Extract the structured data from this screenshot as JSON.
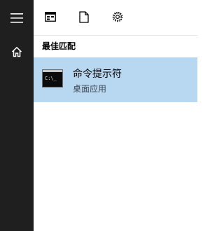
{
  "rail": {
    "menu_icon": "hamburger-menu-icon",
    "home_icon": "home-icon"
  },
  "toolbar": {
    "apps_icon": "apps-window-icon",
    "documents_icon": "document-icon",
    "settings_icon": "gear-icon"
  },
  "section": {
    "title": "最佳匹配"
  },
  "best_match": {
    "title": "命令提示符",
    "subtitle": "桌面应用",
    "icon": "command-prompt-icon",
    "icon_text": "C:\\_",
    "highlight_color": "#b8d7f0"
  },
  "colors": {
    "rail": "#1f1f1f",
    "panel": "#ffffff"
  }
}
